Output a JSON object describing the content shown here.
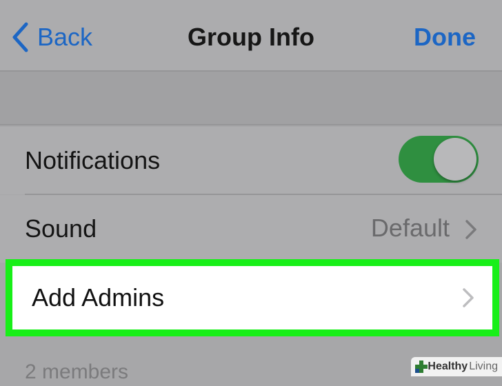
{
  "nav": {
    "back_label": "Back",
    "title": "Group Info",
    "done_label": "Done"
  },
  "settings": {
    "notifications": {
      "label": "Notifications",
      "enabled": true
    },
    "sound": {
      "label": "Sound",
      "value": "Default"
    },
    "add_admins": {
      "label": "Add Admins"
    }
  },
  "members_header": "2 members",
  "watermark": {
    "bold": "Healthy",
    "light": "Living"
  },
  "colors": {
    "accent_blue": "#1c66c4",
    "toggle_on": "#2f8f40",
    "highlight": "#18ef18"
  },
  "icons": [
    "chevron-left-icon",
    "chevron-right-icon",
    "plus-logo-icon"
  ]
}
